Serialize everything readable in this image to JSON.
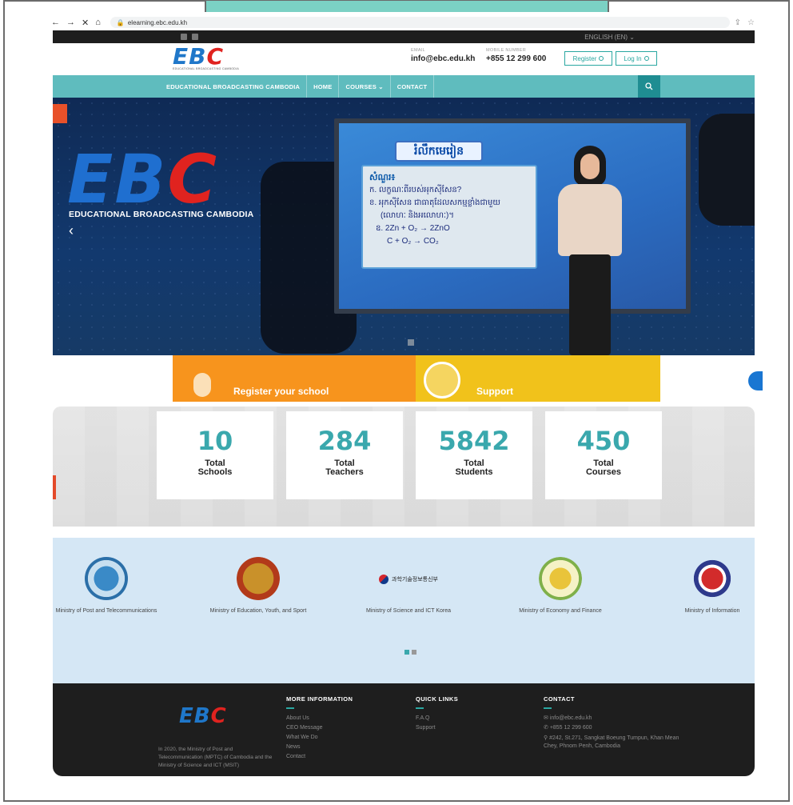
{
  "browser": {
    "url": "elearning.ebc.edu.kh",
    "nav": [
      "←",
      "→",
      "✕",
      "⌂"
    ]
  },
  "topbar": {
    "language": "ENGLISH (EN) ⌄"
  },
  "header": {
    "logo_text": "EBC",
    "logo_sub": "EDUCATIONAL BROADCASTING CAMBODIA",
    "email_label": "EMAIL",
    "email": "info@ebc.edu.kh",
    "phone_label": "MOBILE NUMBER",
    "phone": "+855 12 299 600",
    "register": "Register",
    "login": "Log In"
  },
  "nav": {
    "brand": "EDUCATIONAL BROADCASTING CAMBODIA",
    "home": "HOME",
    "courses": "COURSES ⌄",
    "contact": "CONTACT"
  },
  "hero": {
    "tagline": "EDUCATIONAL BROADCASTING CAMBODIA",
    "lesson_title": "រំលឹកមេរៀន",
    "board_heading": "សំណួរ៖",
    "board_lines": [
      "ក. លក្ខណៈពីរបស់អុកស៊ីសែន?",
      "ខ. អុកស៊ីសែន ជាធាតុដែលសកម្មខ្លាំងជាមួយ",
      "(លោហៈ និងអលោហៈ)។",
      "ឧ. 2Zn + O₂ → 2ZnO",
      "C + O₂ → CO₂"
    ]
  },
  "promo": {
    "register": "Register your school",
    "support": "Support"
  },
  "stats": [
    {
      "value": "10",
      "label": "Total\nSchools"
    },
    {
      "value": "284",
      "label": "Total\nTeachers"
    },
    {
      "value": "5842",
      "label": "Total\nStudents"
    },
    {
      "value": "450",
      "label": "Total\nCourses"
    }
  ],
  "partners": [
    {
      "name": "Ministry of Post and Telecommunications"
    },
    {
      "name": "Ministry of Education, Youth, and Sport"
    },
    {
      "name": "Ministry of Science and ICT Korea",
      "logo_text": "과학기술정보통신부"
    },
    {
      "name": "Ministry of Economy and Finance"
    },
    {
      "name": "Ministry of Information"
    }
  ],
  "footer": {
    "logo": "EBC",
    "about": "In 2020, the Ministry of Post and Telecommunication (MPTC) of Cambodia and the Ministry of Science and ICT (MSIT)",
    "more_info": {
      "heading": "MORE INFORMATION",
      "links": [
        "About Us",
        "CEO Message",
        "What We Do",
        "News",
        "Contact"
      ]
    },
    "quick_links": {
      "heading": "QUICK LINKS",
      "links": [
        "F.A.Q",
        "Support"
      ]
    },
    "contact": {
      "heading": "CONTACT",
      "email": "info@ebc.edu.kh",
      "phone": "+855 12 299 600",
      "address": "#242, St.271, Sangkat Boeung Tumpun, Khan Mean Chey, Phnom Penh, Cambodia"
    }
  },
  "colors": {
    "teal": "#5fbcbe",
    "accent": "#3aa8ad",
    "orange": "#f7941d",
    "yellow": "#f1c21b",
    "brand_blue": "#1f77c9",
    "brand_red": "#e0231f"
  }
}
